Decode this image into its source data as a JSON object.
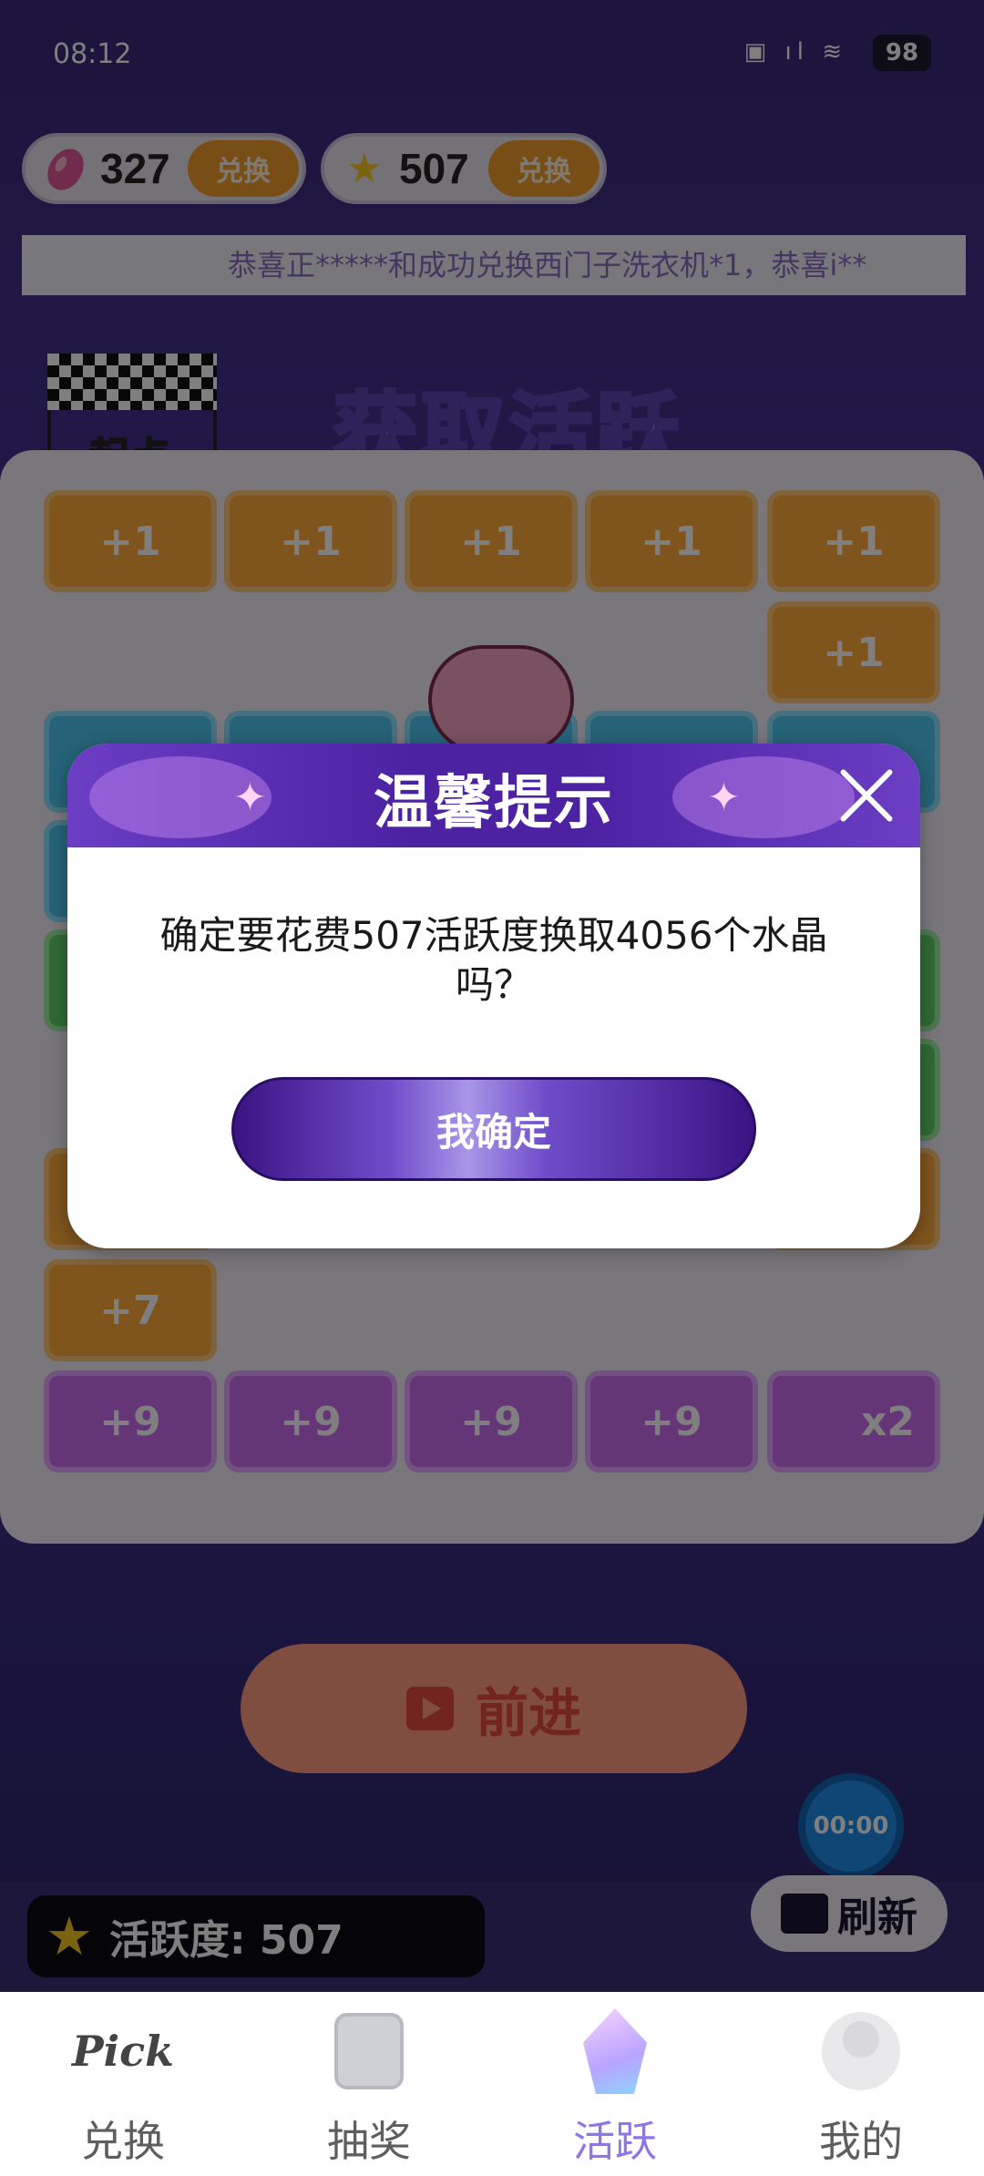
{
  "status": {
    "time": "08:12",
    "battery": "98"
  },
  "currencies": [
    {
      "value": "327",
      "button": "兑换",
      "icon": "gem-icon"
    },
    {
      "value": "507",
      "button": "兑换",
      "icon": "star-icon"
    }
  ],
  "marquee": "恭喜正*****和成功兑换西门子洗衣机*1，恭喜i**",
  "board": {
    "start_label": "起点",
    "title": "获取活跃",
    "tiles_row1": [
      "+1",
      "+1",
      "+1",
      "+1",
      "+1"
    ],
    "tile_col_right": "+1",
    "tile_7": "+7",
    "tiles_row9": [
      "+9",
      "+9",
      "+9",
      "+9"
    ],
    "tile_x2": "x2"
  },
  "forward_button": "前进",
  "timer_text": "00:00",
  "active_label": "活跃度: 507",
  "refresh_button": "刷新",
  "dialog": {
    "title": "温馨提示",
    "message": "确定要花费507活跃度换取4056个水晶吗？",
    "confirm": "我确定"
  },
  "tabs": [
    {
      "label": "兑换",
      "icon": "pick-logo-icon",
      "active": false
    },
    {
      "label": "抽奖",
      "icon": "ticket-icon",
      "active": false
    },
    {
      "label": "活跃",
      "icon": "crystal-icon",
      "active": true
    },
    {
      "label": "我的",
      "icon": "person-icon",
      "active": false
    }
  ],
  "colors": {
    "accent": "#8f76e6",
    "dialog_header": "#4c22a3",
    "currency_button": "#f39a2d"
  }
}
